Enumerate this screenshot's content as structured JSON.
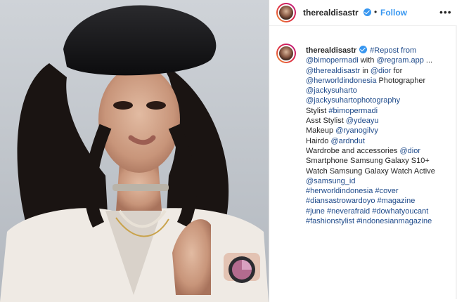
{
  "post": {
    "username": "therealdisastr",
    "follow_label": "Follow",
    "dot_separator": "•",
    "more_label": "•••"
  },
  "caption": {
    "author": "therealdisastr",
    "lines": [
      [
        {
          "t": "#Repost from",
          "link": true
        }
      ],
      [
        {
          "t": "@bimopermadi",
          "link": true
        },
        {
          "t": " with ",
          "link": false
        },
        {
          "t": "@regram.app",
          "link": true
        },
        {
          "t": " ...",
          "link": false
        }
      ],
      [
        {
          "t": "@therealdisastr",
          "link": true
        },
        {
          "t": " in ",
          "link": false
        },
        {
          "t": "@dior",
          "link": true
        },
        {
          "t": " for",
          "link": false
        }
      ],
      [
        {
          "t": "@herworldindonesia",
          "link": true
        },
        {
          "t": " Photographer",
          "link": false
        }
      ],
      [
        {
          "t": "@jackysuharto",
          "link": true
        }
      ],
      [
        {
          "t": "@jackysuhartophotography",
          "link": true
        }
      ],
      [
        {
          "t": "Stylist ",
          "link": false
        },
        {
          "t": "#bimopermadi",
          "link": true
        }
      ],
      [
        {
          "t": "Asst Stylist ",
          "link": false
        },
        {
          "t": "@ydeayu",
          "link": true
        }
      ],
      [
        {
          "t": "Makeup ",
          "link": false
        },
        {
          "t": "@ryanogilvy",
          "link": true
        }
      ],
      [
        {
          "t": "Hairdo ",
          "link": false
        },
        {
          "t": "@ardndut",
          "link": true
        }
      ],
      [
        {
          "t": "Wardrobe and accessories ",
          "link": false
        },
        {
          "t": "@dior",
          "link": true
        }
      ],
      [
        {
          "t": "Smartphone Samsung Galaxy S10+",
          "link": false
        }
      ],
      [
        {
          "t": "Watch Samsung Galaxy Watch Active",
          "link": false
        }
      ],
      [
        {
          "t": "@samsung_id",
          "link": true
        }
      ],
      [
        {
          "t": "#herworldindonesia",
          "link": true
        },
        {
          "t": " ",
          "link": false
        },
        {
          "t": "#cover",
          "link": true
        }
      ],
      [
        {
          "t": "#diansastrowardoyo",
          "link": true
        },
        {
          "t": " ",
          "link": false
        },
        {
          "t": "#magazine",
          "link": true
        }
      ],
      [
        {
          "t": "#june",
          "link": true
        },
        {
          "t": " ",
          "link": false
        },
        {
          "t": "#neverafraid",
          "link": true
        },
        {
          "t": " ",
          "link": false
        },
        {
          "t": "#dowhatyoucant",
          "link": true
        }
      ],
      [
        {
          "t": "#fashionstylist",
          "link": true
        },
        {
          "t": " ",
          "link": false
        },
        {
          "t": "#indonesianmagazine",
          "link": true
        }
      ]
    ]
  },
  "colors": {
    "link": "#1e4a8a",
    "follow": "#3897f0",
    "verified": "#3897f0",
    "text": "#262626"
  },
  "icons": {
    "verified": "verified-badge-icon",
    "more": "more-options-icon"
  }
}
